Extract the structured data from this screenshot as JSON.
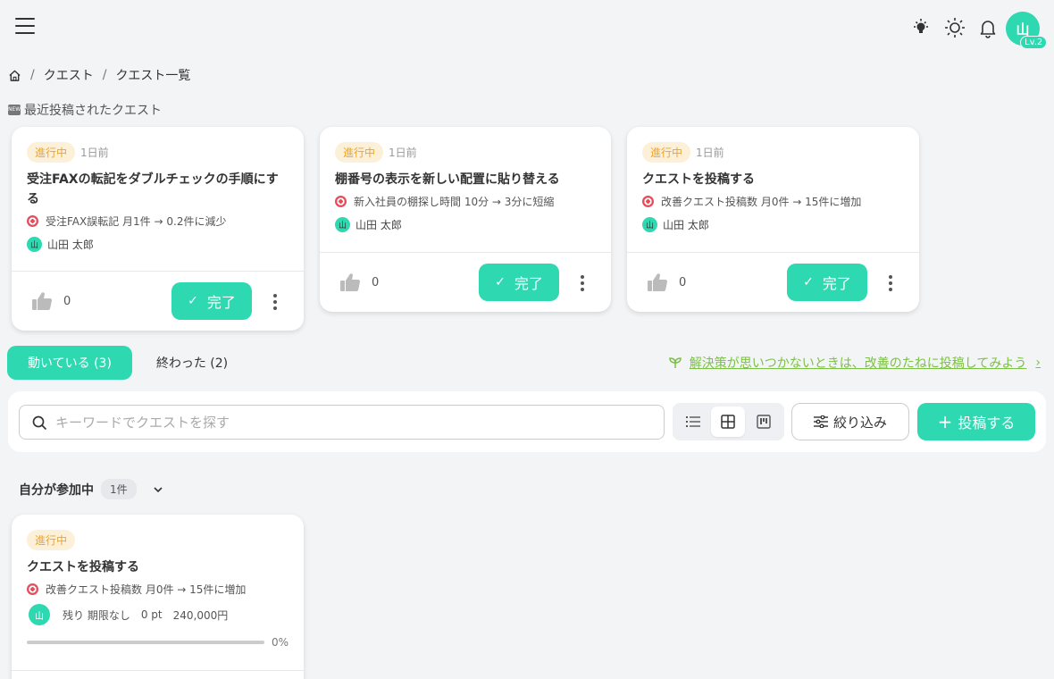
{
  "header": {
    "avatar_initial": "山",
    "level": "Lv.2"
  },
  "breadcrumb": {
    "items": [
      "クエスト",
      "クエスト一覧"
    ],
    "separator": "/"
  },
  "recent": {
    "heading": "最近投稿されたクエスト",
    "new_icon_text": "NEW",
    "cards": [
      {
        "status": "進行中",
        "time": "1日前",
        "title": "受注FAXの転記をダブルチェックの手順にする",
        "goal": "受注FAX誤転記 月1件 → 0.2件に減少",
        "author_initial": "山",
        "author": "山田 太郎",
        "likes": "0",
        "complete_label": "完了"
      },
      {
        "status": "進行中",
        "time": "1日前",
        "title": "棚番号の表示を新しい配置に貼り替える",
        "goal": "新入社員の棚探し時間 10分 → 3分に短縮",
        "author_initial": "山",
        "author": "山田 太郎",
        "likes": "0",
        "complete_label": "完了"
      },
      {
        "status": "進行中",
        "time": "1日前",
        "title": "クエストを投稿する",
        "goal": "改善クエスト投稿数 月0件 → 15件に増加",
        "author_initial": "山",
        "author": "山田 太郎",
        "likes": "0",
        "complete_label": "完了"
      }
    ]
  },
  "tabs": {
    "active": "動いている (3)",
    "inactive": "終わった (2)"
  },
  "hint_link": "解決策が思いつかないときは、改善のたねに投稿してみよう",
  "toolbar": {
    "search_placeholder": "キーワードでクエストを探す",
    "search_value": "",
    "filter_label": "絞り込み",
    "post_label": "投稿する",
    "active_view": "grid"
  },
  "group": {
    "title": "自分が参加中",
    "count": "1件",
    "quest": {
      "status": "進行中",
      "title": "クエストを投稿する",
      "goal": "改善クエスト投稿数 月0件 → 15件に増加",
      "avatar_initial": "山",
      "remaining": "残り 期限なし",
      "points": "0 pt",
      "budget": "240,000円",
      "progress": 0,
      "progress_label": "0%"
    }
  },
  "colors": {
    "accent": "#2ed8b1",
    "status_bg": "#fdf0d8",
    "status_text": "#f0a422",
    "hint_green": "#7bc144"
  }
}
